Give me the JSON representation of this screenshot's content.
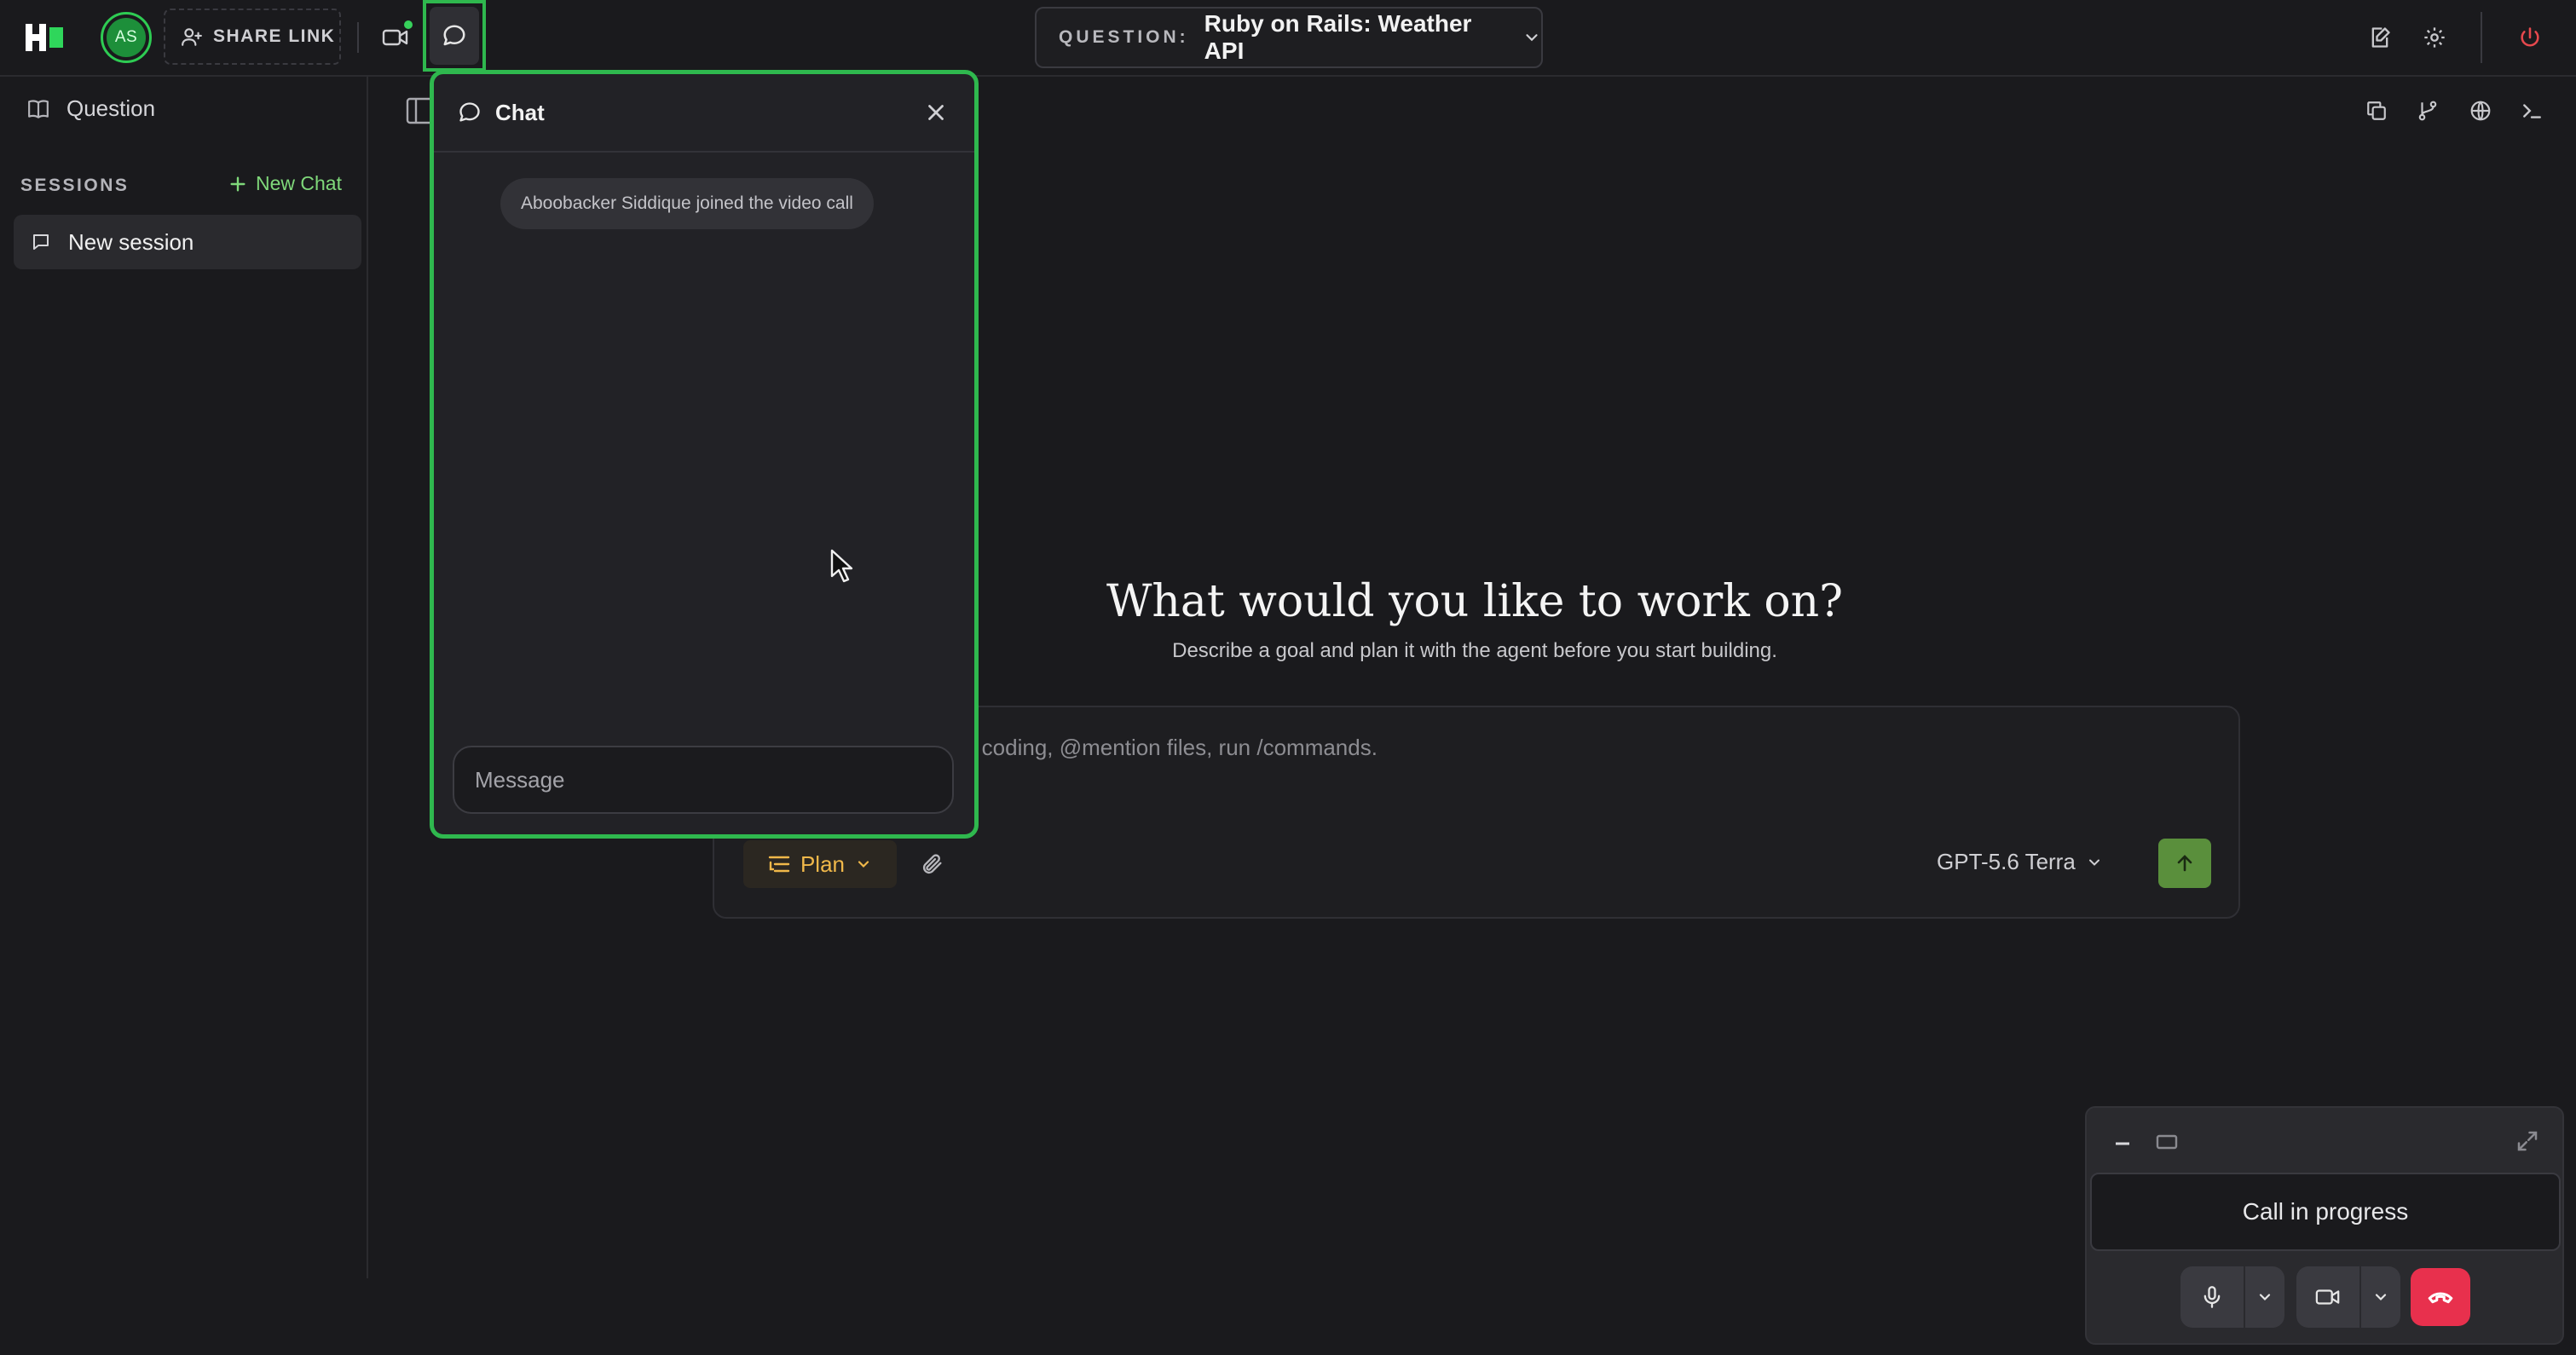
{
  "topbar": {
    "avatar_initials": "AS",
    "share_link_label": "SHARE LINK",
    "question_label": "QUESTION:",
    "question_value": "Ruby on Rails: Weather API"
  },
  "sidebar": {
    "question_label": "Question",
    "sessions_label": "SESSIONS",
    "new_chat_label": "New Chat",
    "sessions": [
      {
        "label": "New session"
      }
    ]
  },
  "main": {
    "hero_title": "What would you like to work on?",
    "hero_subtitle": "Describe a goal and plan it with the agent before you start building.",
    "composer_placeholder": "e coding, @mention files, run /commands.",
    "mode_label": "Plan",
    "model_label": "GPT-5.6 Terra"
  },
  "chat": {
    "title": "Chat",
    "system_message": "Aboobacker Siddique joined the video call",
    "input_placeholder": "Message"
  },
  "call": {
    "status": "Call in progress"
  },
  "colors": {
    "accent_green": "#2fb84e",
    "new_chat_green": "#7fd87a",
    "plan_amber": "#f0b84a",
    "send_green": "#5a8f3c",
    "hangup_red": "#e8304d",
    "power_red": "#e5484d"
  },
  "icons": {
    "logo": "brand-logo",
    "share": "user-plus-icon",
    "video": "video-camera-icon",
    "chat": "chat-bubble-icon",
    "question": "book-icon",
    "new_chat": "plus-icon",
    "session": "chat-bubble-icon",
    "plan": "list-icon",
    "attach": "paperclip-icon",
    "send": "arrow-up-icon",
    "mic": "microphone-icon",
    "hangup": "phone-hangup-icon"
  }
}
